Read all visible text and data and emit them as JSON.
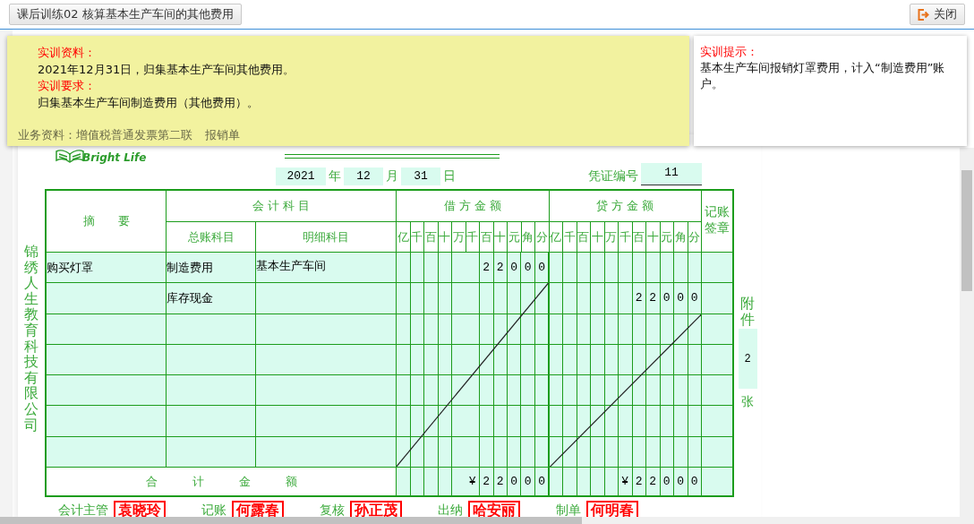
{
  "header": {
    "title_tab": "课后训练02 核算基本生产车间的其他费用",
    "close_button": "关闭"
  },
  "task_panel": {
    "sections": [
      {
        "heading": "实训资料：",
        "text": "2021年12月31日，归集基本生产车间其他费用。"
      },
      {
        "heading": "实训要求：",
        "text": "归集基本生产车间制造费用（其他费用）。"
      }
    ],
    "materials": {
      "label": "业务资料：",
      "links": [
        "增值税普通发票第二联",
        "报销单"
      ]
    }
  },
  "hint_panel": {
    "heading": "实训提示：",
    "text": "基本生产车间报销灯罩费用，计入“制造费用”账户。"
  },
  "voucher": {
    "logo_text": "Bright Life",
    "date": {
      "year": "2021",
      "year_label": "年",
      "month": "12",
      "month_label": "月",
      "day": "31",
      "day_label": "日"
    },
    "number_label": "凭证编号",
    "number": "11",
    "company": "锦绣人生教育科技有限公司",
    "headers": {
      "summary": "摘　　要",
      "accounts": "会 计 科 目",
      "general_account": "总账科目",
      "detail_account": "明细科目",
      "debit": "借 方 金 额",
      "credit": "贷 方 金 额",
      "sign": "记账签章"
    },
    "debit_units": [
      "亿",
      "千",
      "百",
      "十",
      "万",
      "千",
      "百",
      "十",
      "元",
      "角",
      "分"
    ],
    "credit_units": [
      "亿",
      "千",
      "百",
      "十",
      "万",
      "千",
      "百",
      "十",
      "元",
      "角",
      "分"
    ],
    "rows": [
      {
        "summary": "购买灯罩",
        "account": "制造费用",
        "detail": "基本生产车间",
        "debit": "22000"
      },
      {
        "account": "库存现金",
        "credit": "22000"
      },
      {},
      {},
      {},
      {},
      {}
    ],
    "total": {
      "label": "合　　　计　　　金　　　额",
      "debit": "¥22000",
      "credit": "¥22000"
    },
    "attachments": {
      "label_top": "附件",
      "count": "2",
      "label_bottom": "张"
    },
    "signatures": [
      {
        "role": "会计主管",
        "name": "袁晓玲"
      },
      {
        "role": "记账",
        "name": "何露春"
      },
      {
        "role": "复核",
        "name": "孙正茂"
      },
      {
        "role": "出纳",
        "name": "哈安丽"
      },
      {
        "role": "制单",
        "name": "何明春"
      }
    ]
  }
}
